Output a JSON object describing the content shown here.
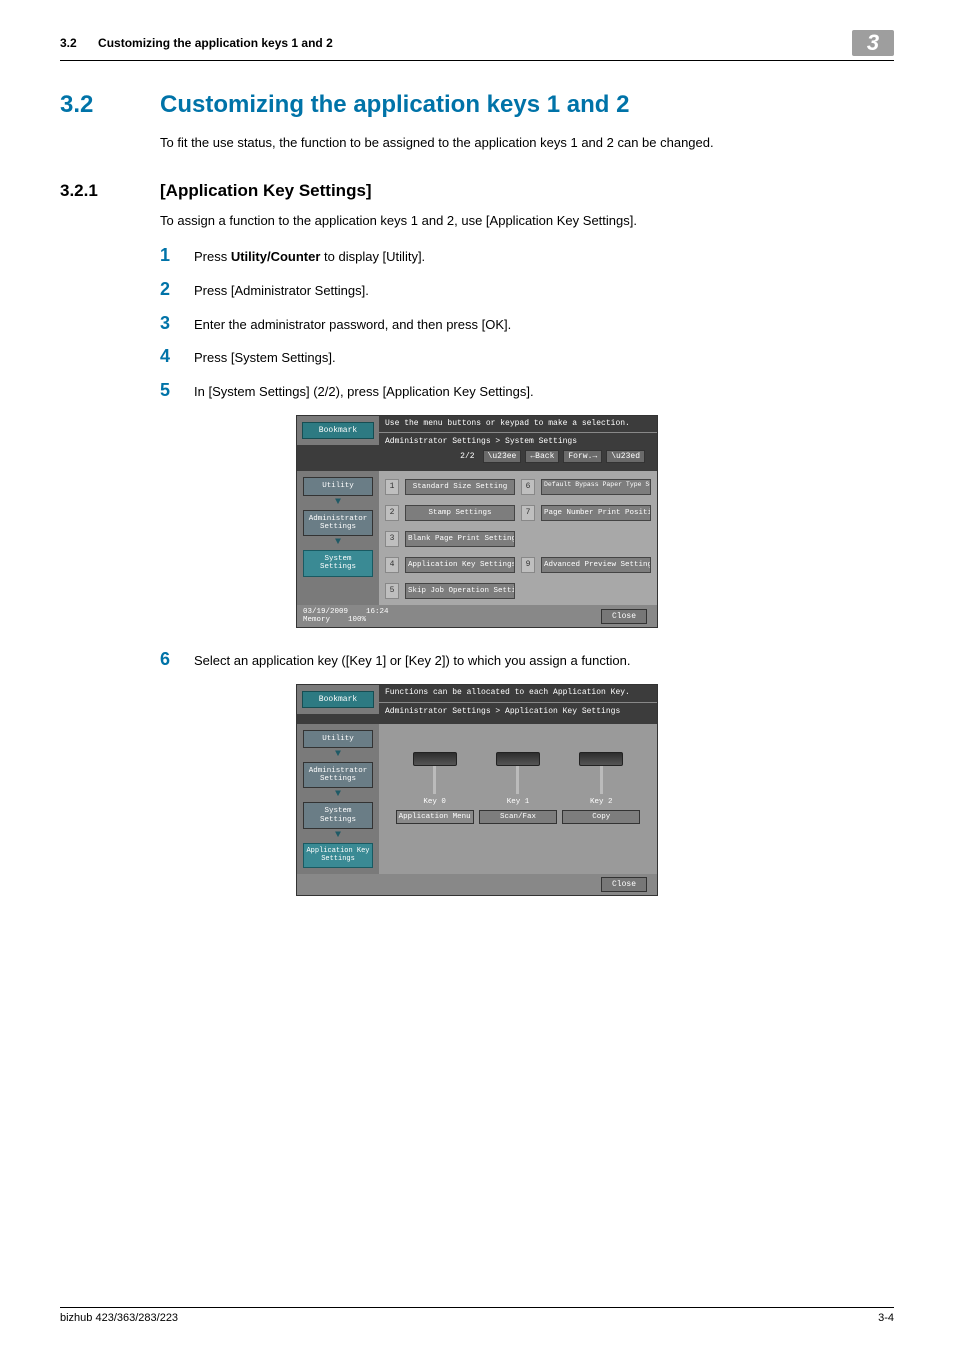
{
  "header": {
    "section_num": "3.2",
    "section_title": "Customizing the application keys 1 and 2",
    "chapter_badge": "3"
  },
  "h1": {
    "num": "3.2",
    "title": "Customizing the application keys 1 and 2",
    "intro": "To fit the use status, the function to be assigned to the application keys 1 and 2 can be changed."
  },
  "h2": {
    "num": "3.2.1",
    "title": "[Application Key Settings]",
    "intro": "To assign a function to the application keys 1 and 2, use [Application Key Settings]."
  },
  "steps": {
    "s1_pre": "Press ",
    "s1_bold": "Utility/Counter",
    "s1_post": " to display [Utility].",
    "s2": "Press [Administrator Settings].",
    "s3": "Enter the administrator password, and then press [OK].",
    "s4": "Press [System Settings].",
    "s5": "In [System Settings] (2/2), press [Application Key Settings].",
    "s6": "Select an application key ([Key 1] or [Key 2]) to which you assign a function."
  },
  "step_nums": {
    "n1": "1",
    "n2": "2",
    "n3": "3",
    "n4": "4",
    "n5": "5",
    "n6": "6"
  },
  "ss1": {
    "topmsg": "Use the menu buttons or keypad to make a selection.",
    "bookmark": "Bookmark",
    "breadcrumb": "Administrator Settings > System Settings",
    "page": "2/2",
    "back": "←Back",
    "fwd": "Forw.→",
    "side_utility": "Utility",
    "side_admin": "Administrator Settings",
    "side_system": "System Settings",
    "opt1": "Standard Size Setting",
    "opt2": "Stamp Settings",
    "opt3": "Blank Page Print Settings",
    "opt4": "Application Key Settings",
    "opt5": "Skip Job Operation Settings",
    "opt6": "Default Bypass Paper Type Setting",
    "opt7": "Page Number Print Position",
    "opt9": "Advanced Preview Setting",
    "n1": "1",
    "n2": "2",
    "n3": "3",
    "n4": "4",
    "n5": "5",
    "n6": "6",
    "n7": "7",
    "n9": "9",
    "foot_date": "03/19/2009",
    "foot_time": "16:24",
    "foot_mem_lbl": "Memory",
    "foot_mem_val": "100%",
    "close": "Close"
  },
  "ss2": {
    "topmsg": "Functions can be allocated to each Application Key.",
    "bookmark": "Bookmark",
    "breadcrumb": "Administrator Settings > Application Key Settings",
    "side_utility": "Utility",
    "side_admin": "Administrator Settings",
    "side_system": "System Settings",
    "side_app": "Application Key Settings",
    "key0_lbl": "Key 0",
    "key0_btn": "Application Menu",
    "key1_lbl": "Key 1",
    "key1_btn": "Scan/Fax",
    "key2_lbl": "Key 2",
    "key2_btn": "Copy",
    "close": "Close"
  },
  "footer": {
    "left": "bizhub 423/363/283/223",
    "right": "3-4"
  }
}
